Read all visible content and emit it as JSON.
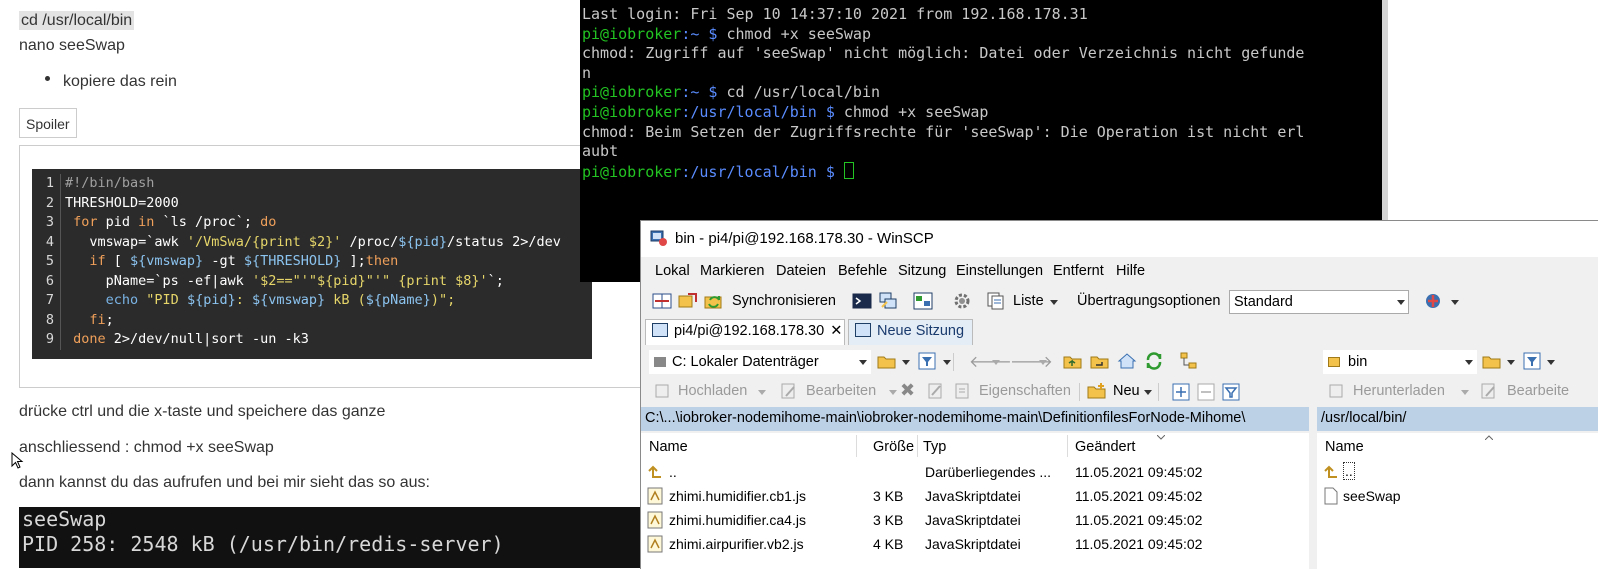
{
  "post": {
    "line1": "cd /usr/local/bin",
    "line2": "nano seeSwap",
    "bullet": "kopiere das rein",
    "spoiler_label": "Spoiler",
    "code_lines": [
      {
        "n": "1"
      },
      {
        "n": "2"
      },
      {
        "n": "3"
      },
      {
        "n": "4"
      },
      {
        "n": "5"
      },
      {
        "n": "6"
      },
      {
        "n": "7"
      },
      {
        "n": "8"
      },
      {
        "n": "9"
      }
    ],
    "code": {
      "l1": "#!/bin/bash",
      "l2": "THRESHOLD=2000",
      "l3a": " for",
      "l3b": " pid",
      "l3c": " in",
      "l3d": " `ls /proc`;",
      "l3e": " do",
      "l4a": "   vmswap=`awk ",
      "l4b": "'/VmSwa/{print $2}'",
      "l4c": " /proc/",
      "l4d": "${pid}",
      "l4e": "/status 2>/dev",
      "l5a": "   if",
      "l5b": " [ ",
      "l5c": "${vmswap}",
      "l5d": " -gt ",
      "l5e": "${THRESHOLD}",
      "l5f": " ];",
      "l5g": "then",
      "l6a": "     pName=`ps -ef|awk ",
      "l6b": "'$2==\"'\"${pid}\"'\" {print $8}'",
      "l6c": "`;",
      "l7a": "     echo",
      "l7b": " \"PID ",
      "l7c": "${pid}",
      "l7d": ": ",
      "l7e": "${vmswap}",
      "l7f": " kB (",
      "l7g": "${pName}",
      "l7h": ")\";",
      "l8a": "   fi",
      "l8b": ";",
      "l9a": " done",
      "l9b": " 2>/dev/null|sort -un -k3"
    },
    "line3": "drücke ctrl und die x-taste und speichere das ganze",
    "line4": "anschliessend : chmod +x seeSwap",
    "line5": "dann kannst du das aufrufen und bei mir sieht das so aus:",
    "mini_term": [
      "seeSwap",
      "PID 258: 2548 kB (/usr/bin/redis-server)"
    ]
  },
  "terminal": {
    "last_login": "Last login: Fri Sep 10 14:37:10 2021 from 192.168.178.31",
    "prompt_user": "pi@iobroker",
    "home": ":~ $ ",
    "bin": ":/usr/local/bin $ ",
    "cmd1": "chmod +x seeSwap",
    "err1a": "chmod: Zugriff auf 'seeSwap' nicht möglich: Datei oder Verzeichnis nicht gefunde",
    "err1b": "n",
    "cmd2": "cd /usr/local/bin",
    "cmd3": "chmod +x seeSwap",
    "err2a": "chmod: Beim Setzen der Zugriffsrechte für 'seeSwap': Die Operation ist nicht erl",
    "err2b": "aubt"
  },
  "winscp": {
    "title": "bin - pi4/pi@192.168.178.30 - WinSCP",
    "menu": [
      "Lokal",
      "Markieren",
      "Dateien",
      "Befehle",
      "Sitzung",
      "Einstellungen",
      "Entfernt",
      "Hilfe"
    ],
    "toolbar1": {
      "sync": "Synchronisieren",
      "list": "Liste",
      "transfer_options": "Übertragungsoptionen",
      "transfer_value": "Standard"
    },
    "tabs": {
      "session": "pi4/pi@192.168.178.30",
      "new_session": "Neue Sitzung"
    },
    "local": {
      "drive": "C: Lokaler Datenträger",
      "upload": "Hochladen",
      "edit": "Bearbeiten",
      "properties": "Eigenschaften",
      "new": "Neu",
      "path": "C:\\...\\iobroker-nodemihome-main\\iobroker-nodemihome-main\\DefinitionfilesForNode-Mihome\\",
      "columns": {
        "name": "Name",
        "size": "Größe",
        "type": "Typ",
        "changed": "Geändert"
      },
      "rows": [
        {
          "name": "..",
          "size": "",
          "type": "Darüberliegendes ...",
          "changed": "11.05.2021  09:45:02"
        },
        {
          "name": "zhimi.humidifier.cb1.js",
          "size": "3 KB",
          "type": "JavaSkriptdatei",
          "changed": "11.05.2021  09:45:02"
        },
        {
          "name": "zhimi.humidifier.ca4.js",
          "size": "3 KB",
          "type": "JavaSkriptdatei",
          "changed": "11.05.2021  09:45:02"
        },
        {
          "name": "zhimi.airpurifier.vb2.js",
          "size": "4 KB",
          "type": "JavaSkriptdatei",
          "changed": "11.05.2021  09:45:02"
        }
      ]
    },
    "remote": {
      "folder": "bin",
      "download": "Herunterladen",
      "edit": "Bearbeite",
      "path": "/usr/local/bin/",
      "columns": {
        "name": "Name"
      },
      "rows": [
        {
          "name": ".."
        },
        {
          "name": "seeSwap"
        }
      ]
    }
  }
}
